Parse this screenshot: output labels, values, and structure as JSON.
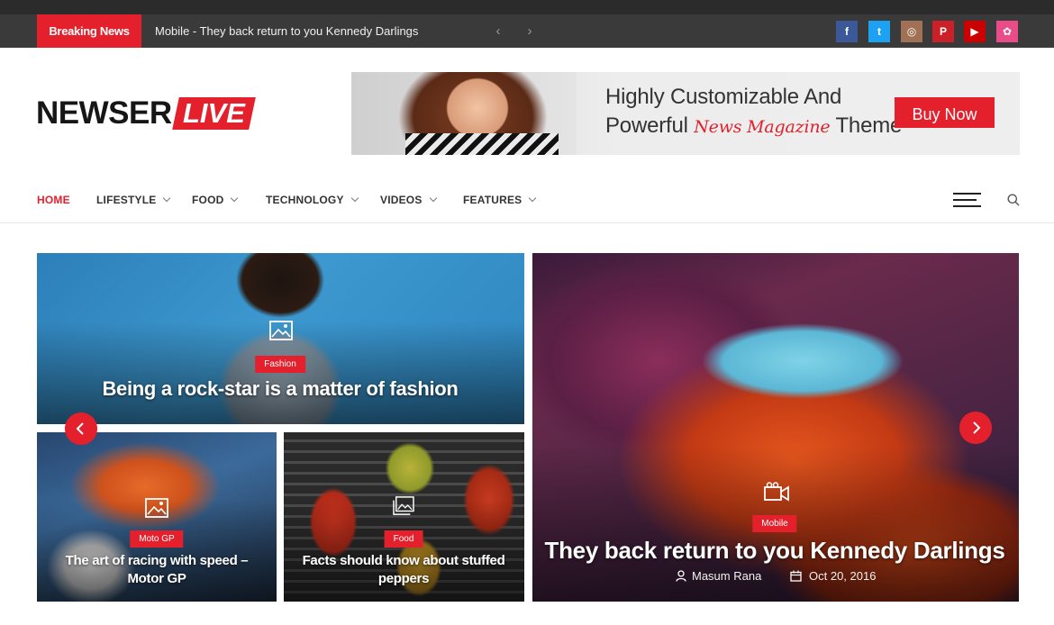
{
  "topbar": {
    "breaking_label": "Breaking News",
    "breaking_text": "Mobile - They back return to you Kennedy Darlings",
    "prev_glyph": "‹",
    "next_glyph": "›",
    "social": [
      {
        "icon": "facebook-icon",
        "glyph": "f",
        "color": "#3b5998"
      },
      {
        "icon": "twitter-icon",
        "glyph": "t",
        "color": "#1da1f2"
      },
      {
        "icon": "instagram-icon",
        "glyph": "◎",
        "color": "#a17155"
      },
      {
        "icon": "pinterest-icon",
        "glyph": "P",
        "color": "#cb2027"
      },
      {
        "icon": "youtube-icon",
        "glyph": "▶",
        "color": "#cc0000"
      },
      {
        "icon": "dribbble-icon",
        "glyph": "✿",
        "color": "#ea4c89"
      }
    ]
  },
  "header": {
    "logo_main": "NEWSER",
    "logo_live": "LIVE",
    "ad": {
      "line1": "Highly Customizable And",
      "line2_start": "Powerful",
      "line2_script": "News Magazine",
      "line2_end": "Theme",
      "button": "Buy Now"
    }
  },
  "nav": {
    "items": [
      "HOME",
      "LIFESTYLE",
      "FOOD",
      "TECHNOLOGY",
      "VIDEOS",
      "FEATURES"
    ],
    "active_index": 0
  },
  "posts": {
    "fashion": {
      "category": "Fashion",
      "title": "Being a rock-star is a matter of fashion",
      "media": "image-icon"
    },
    "motogp": {
      "category": "Moto GP",
      "title_line1": "The art of racing with speed –",
      "title_line2": "Motor GP",
      "media": "image-icon"
    },
    "food": {
      "category": "Food",
      "title_line1": "Facts should know about stuffed",
      "title_line2": "peppers",
      "media": "gallery-icon"
    },
    "mobile": {
      "category": "Mobile",
      "title": "They back return to you Kennedy Darlings",
      "author": "Masum Rana",
      "date": "Oct 20, 2016",
      "media": "video-camera-icon"
    }
  },
  "colors": {
    "accent": "#e3202c",
    "topbar": "#3a3a3a"
  }
}
